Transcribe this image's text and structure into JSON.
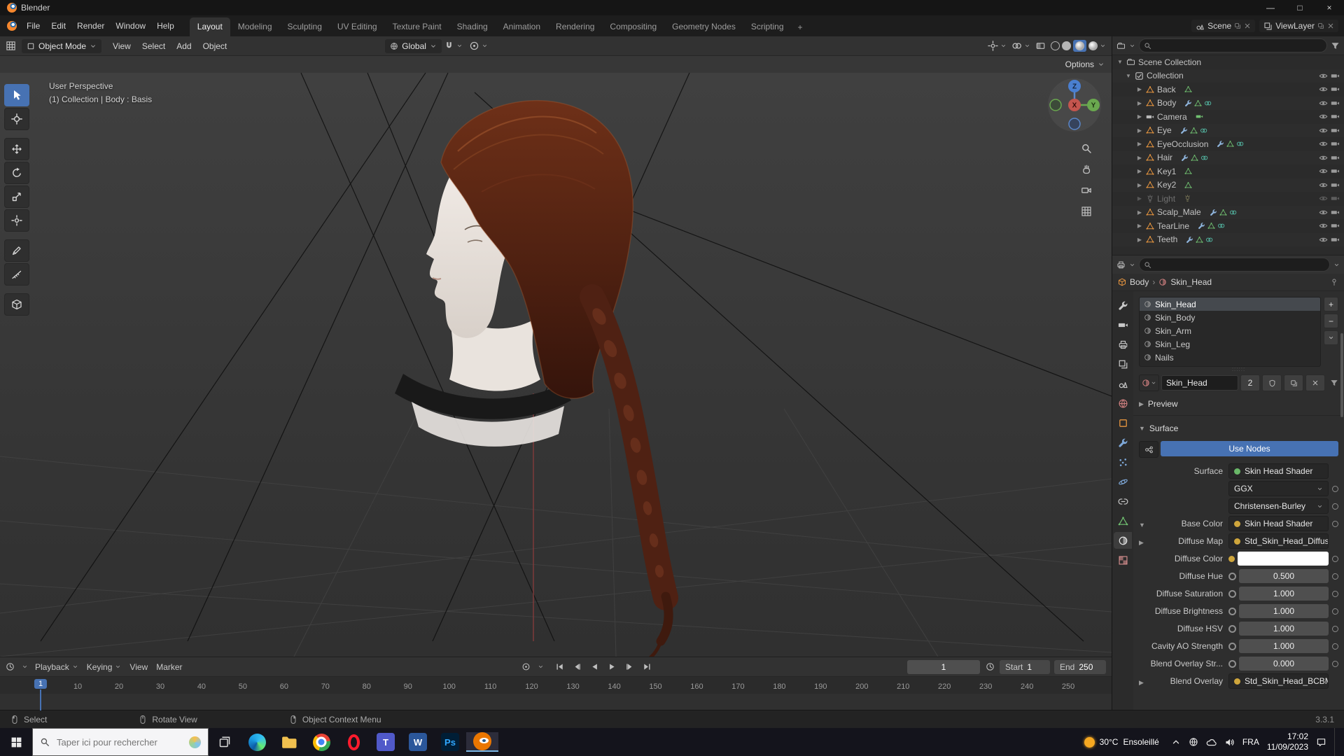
{
  "window": {
    "title": "Blender",
    "minimize": "—",
    "maximize": "□",
    "close": "×"
  },
  "topbar": {
    "menus": [
      "File",
      "Edit",
      "Render",
      "Window",
      "Help"
    ],
    "workspaces": [
      "Layout",
      "Modeling",
      "Sculpting",
      "UV Editing",
      "Texture Paint",
      "Shading",
      "Animation",
      "Rendering",
      "Compositing",
      "Geometry Nodes",
      "Scripting"
    ],
    "active_workspace": "Layout",
    "add_tab": "+",
    "scene_label": "Scene",
    "viewlayer_label": "ViewLayer"
  },
  "viewport": {
    "header": {
      "mode": "Object Mode",
      "menus": [
        "View",
        "Select",
        "Add",
        "Object"
      ],
      "orientation": "Global",
      "options": "Options"
    },
    "overlay": {
      "line1": "User Perspective",
      "line2": "(1) Collection | Body : Basis"
    },
    "gizmo": {
      "up": "Z",
      "right": "Y",
      "front": "X"
    }
  },
  "tools": [
    {
      "name": "select-box",
      "icon": "arrow",
      "active": true
    },
    {
      "name": "cursor",
      "icon": "crosshair"
    },
    {
      "name": "move",
      "icon": "move",
      "break": true
    },
    {
      "name": "rotate",
      "icon": "rotate"
    },
    {
      "name": "scale",
      "icon": "scale"
    },
    {
      "name": "transform",
      "icon": "transform"
    },
    {
      "name": "annotate",
      "icon": "pen",
      "break": true
    },
    {
      "name": "measure",
      "icon": "measure"
    },
    {
      "name": "add-cube",
      "icon": "cube",
      "break": true
    }
  ],
  "outliner": {
    "root": "Scene Collection",
    "collection": "Collection",
    "items": [
      {
        "name": "Back",
        "type": "mesh",
        "badges": [
          "mesh-data"
        ]
      },
      {
        "name": "Body",
        "type": "mesh",
        "badges": [
          "modifier",
          "mesh-data",
          "shapekey"
        ]
      },
      {
        "name": "Camera",
        "type": "camera",
        "badges": [
          "camera-data"
        ]
      },
      {
        "name": "Eye",
        "type": "mesh",
        "badges": [
          "modifier",
          "mesh-data",
          "shapekey"
        ]
      },
      {
        "name": "EyeOcclusion",
        "type": "mesh",
        "badges": [
          "modifier",
          "mesh-data",
          "shapekey"
        ]
      },
      {
        "name": "Hair",
        "type": "mesh",
        "badges": [
          "modifier",
          "mesh-data",
          "shapekey"
        ]
      },
      {
        "name": "Key1",
        "type": "mesh",
        "badges": [
          "mesh-data"
        ]
      },
      {
        "name": "Key2",
        "type": "mesh",
        "badges": [
          "mesh-data"
        ]
      },
      {
        "name": "Light",
        "type": "light",
        "badges": [
          "light-data"
        ],
        "dimmed": true
      },
      {
        "name": "Scalp_Male",
        "type": "mesh",
        "badges": [
          "modifier",
          "mesh-data",
          "shapekey"
        ]
      },
      {
        "name": "TearLine",
        "type": "mesh",
        "badges": [
          "modifier",
          "mesh-data",
          "shapekey"
        ]
      },
      {
        "name": "Teeth",
        "type": "mesh",
        "badges": [
          "modifier",
          "mesh-data",
          "shapekey"
        ]
      }
    ]
  },
  "properties": {
    "breadcrumb": {
      "object": "Body",
      "separator": "›",
      "material": "Skin_Head"
    },
    "tabs": [
      "tool",
      "render",
      "output",
      "viewlayer",
      "scene",
      "world",
      "object",
      "modifiers",
      "particles",
      "physics",
      "constraints",
      "data",
      "material",
      "texture"
    ],
    "active_tab": "material",
    "slots": [
      {
        "name": "Skin_Head",
        "selected": true
      },
      {
        "name": "Skin_Body"
      },
      {
        "name": "Skin_Arm"
      },
      {
        "name": "Skin_Leg"
      },
      {
        "name": "Nails"
      }
    ],
    "datablock": {
      "name": "Skin_Head",
      "users": "2"
    },
    "panels": {
      "preview": "Preview",
      "surface": "Surface"
    },
    "use_nodes": "Use Nodes",
    "fields": [
      {
        "label": "Surface",
        "socket": "green",
        "widget": "button",
        "value": "Skin Head Shader",
        "dot": false
      },
      {
        "label": "",
        "widget": "dropdown",
        "value": "GGX",
        "dot": true
      },
      {
        "label": "",
        "widget": "dropdown",
        "value": "Christensen-Burley",
        "dot": true
      },
      {
        "label": "Base Color",
        "disclosure": "open",
        "socket": "yellow",
        "widget": "button",
        "value": "Skin Head Shader",
        "dot": true
      },
      {
        "label": "Diffuse Map",
        "disclosure": "closed",
        "socket": "yellow",
        "widget": "button",
        "value": "Std_Skin_Head_Diffuse",
        "dot": false
      },
      {
        "label": "Diffuse Color",
        "socket": "yellow",
        "widget": "swatch",
        "value": "#ffffff",
        "dot": true
      },
      {
        "label": "Diffuse Hue",
        "socket": "gray",
        "widget": "slider",
        "value": "0.500",
        "dot": true
      },
      {
        "label": "Diffuse Saturation",
        "socket": "gray",
        "widget": "slider",
        "value": "1.000",
        "dot": true
      },
      {
        "label": "Diffuse Brightness",
        "socket": "gray",
        "widget": "slider",
        "value": "1.000",
        "dot": true
      },
      {
        "label": "Diffuse HSV",
        "socket": "gray",
        "widget": "slider",
        "value": "1.000",
        "dot": true
      },
      {
        "label": "Cavity AO Strength",
        "socket": "gray",
        "widget": "slider",
        "value": "1.000",
        "dot": true
      },
      {
        "label": "Blend Overlay Str...",
        "socket": "gray",
        "widget": "slider",
        "value": "0.000",
        "dot": true
      },
      {
        "label": "Blend Overlay",
        "disclosure": "closed",
        "socket": "yellow",
        "widget": "button",
        "value": "Std_Skin_Head_BCBMa...",
        "dot": false
      }
    ]
  },
  "timeline": {
    "menus": [
      "Playback",
      "Keying",
      "View",
      "Marker"
    ],
    "frame": "1",
    "playhead": "1",
    "start": {
      "label": "Start",
      "value": "1"
    },
    "end": {
      "label": "End",
      "value": "250"
    },
    "ticks": [
      1,
      10,
      20,
      30,
      40,
      50,
      60,
      70,
      80,
      90,
      100,
      110,
      120,
      130,
      140,
      150,
      160,
      170,
      180,
      190,
      200,
      210,
      220,
      230,
      240,
      250
    ]
  },
  "statusbar": {
    "items": [
      {
        "label": "Select",
        "button": "left"
      },
      {
        "label": "Rotate View",
        "button": "middle"
      },
      {
        "label": "Object Context Menu",
        "button": "right"
      }
    ],
    "version": "3.3.1"
  },
  "taskbar": {
    "search_placeholder": "Taper ici pour rechercher",
    "apps": [
      {
        "name": "task-view"
      },
      {
        "name": "edge"
      },
      {
        "name": "explorer"
      },
      {
        "name": "chrome"
      },
      {
        "name": "opera"
      },
      {
        "name": "teams",
        "letter": "T",
        "color": "#5059c9"
      },
      {
        "name": "word",
        "letter": "W",
        "color": "#2b579a"
      },
      {
        "name": "photoshop",
        "letter": "Ps",
        "color": "#001e36",
        "fg": "#31a8ff"
      },
      {
        "name": "blender",
        "active": true
      }
    ],
    "tray": {
      "weather_temp": "30°C",
      "weather_desc": "Ensoleillé",
      "lang": "FRA",
      "time": "17:02",
      "date": "11/09/2023"
    }
  },
  "colors": {
    "accent": "#4772b3",
    "selection": "#e87d0d",
    "use_nodes_blue": "#4772b3"
  }
}
